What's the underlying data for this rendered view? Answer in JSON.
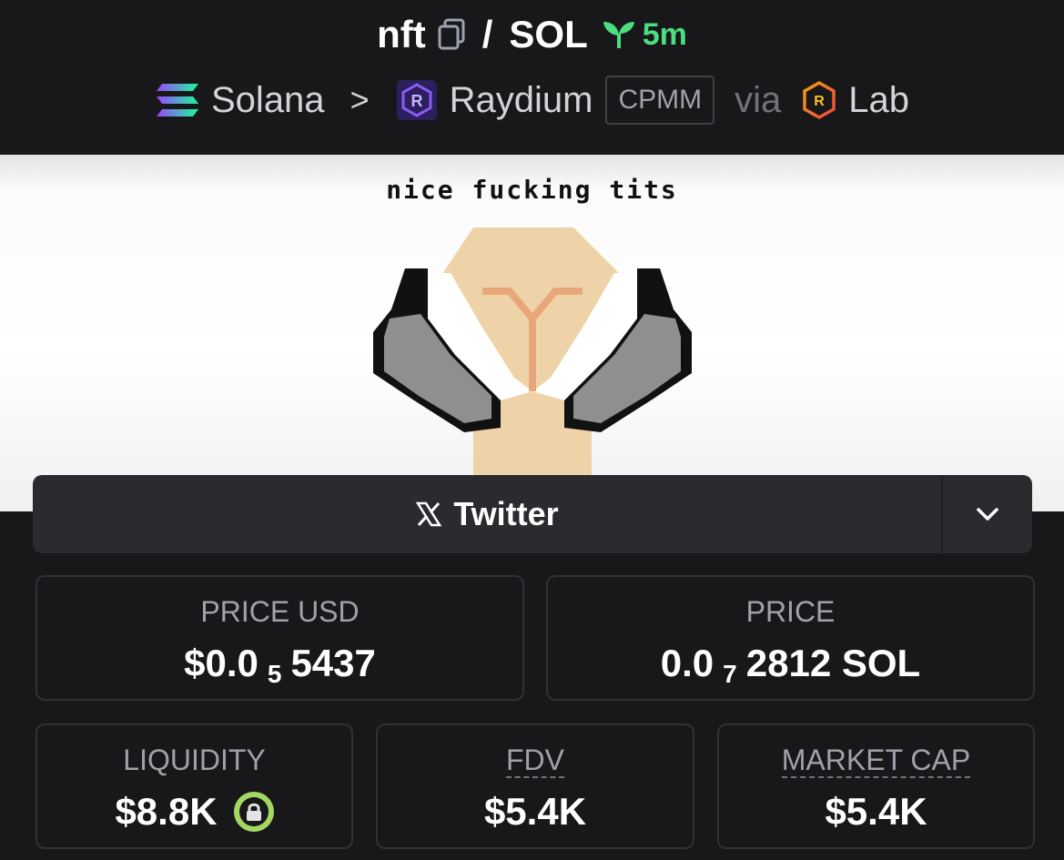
{
  "header": {
    "token_symbol": "nft",
    "separator": "/",
    "quote_symbol": "SOL",
    "age": "5m",
    "chain": "Solana",
    "dex": "Raydium",
    "pool_type": "CPMM",
    "via_label": "via",
    "launchpad": "Lab"
  },
  "banner": {
    "caption": "nice fucking tits"
  },
  "socials": {
    "primary_label": "Twitter",
    "primary_icon": "x-logo-icon",
    "dropdown_icon": "chevron-down-icon"
  },
  "stats": {
    "price_usd": {
      "label": "PRICE USD",
      "prefix": "$0.0",
      "zeros": "5",
      "digits": "5437"
    },
    "price_native": {
      "label": "PRICE",
      "prefix": "0.0",
      "zeros": "7",
      "digits": "2812 SOL"
    },
    "liquidity": {
      "label": "LIQUIDITY",
      "value": "$8.8K",
      "locked": true
    },
    "fdv": {
      "label": "FDV",
      "value": "$5.4K"
    },
    "market_cap": {
      "label": "MARKET CAP",
      "value": "$5.4K"
    }
  },
  "colors": {
    "background": "#18181b",
    "age_green": "#4ade80",
    "lock_green": "#a3d963",
    "raydium_purple": "#7c3aed"
  }
}
